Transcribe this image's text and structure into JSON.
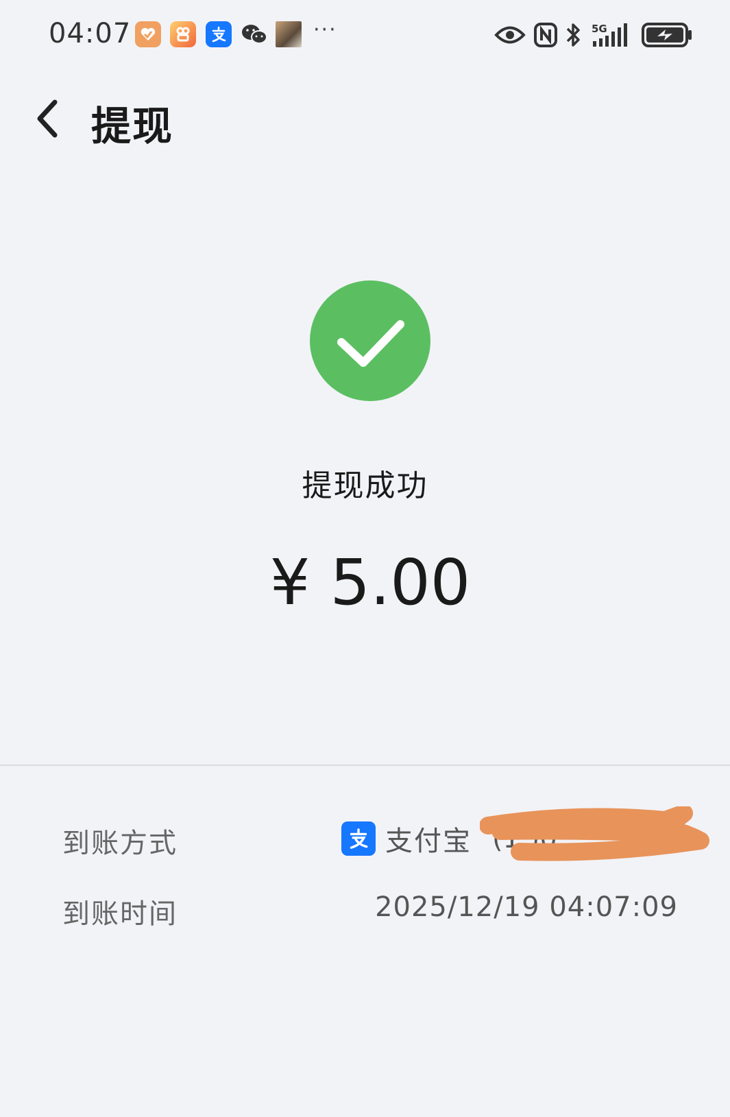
{
  "status_bar": {
    "time": "04:07",
    "notification_icons": [
      "health-app-icon",
      "shopping-app-icon",
      "alipay-icon",
      "wechat-icon",
      "photo-thumbnail-icon"
    ],
    "more": "···",
    "system_icons": [
      "eye-icon",
      "nfc-icon",
      "bluetooth-icon",
      "signal-5g-icon",
      "battery-charging-icon"
    ],
    "network_label": "5G"
  },
  "header": {
    "title": "提现",
    "back_icon": "chevron-left-icon"
  },
  "result": {
    "icon": "check-circle-icon",
    "status_text": "提现成功",
    "amount": "¥ 5.00",
    "success_color": "#5bbf62"
  },
  "details": {
    "method_label": "到账方式",
    "method_logo_text": "支",
    "method_name": "支付宝",
    "method_account": "(1 )0",
    "time_label": "到账时间",
    "time_value": "2025/12/19 04:07:09",
    "redaction_color": "#e8935a",
    "alipay_color": "#1677ff"
  }
}
